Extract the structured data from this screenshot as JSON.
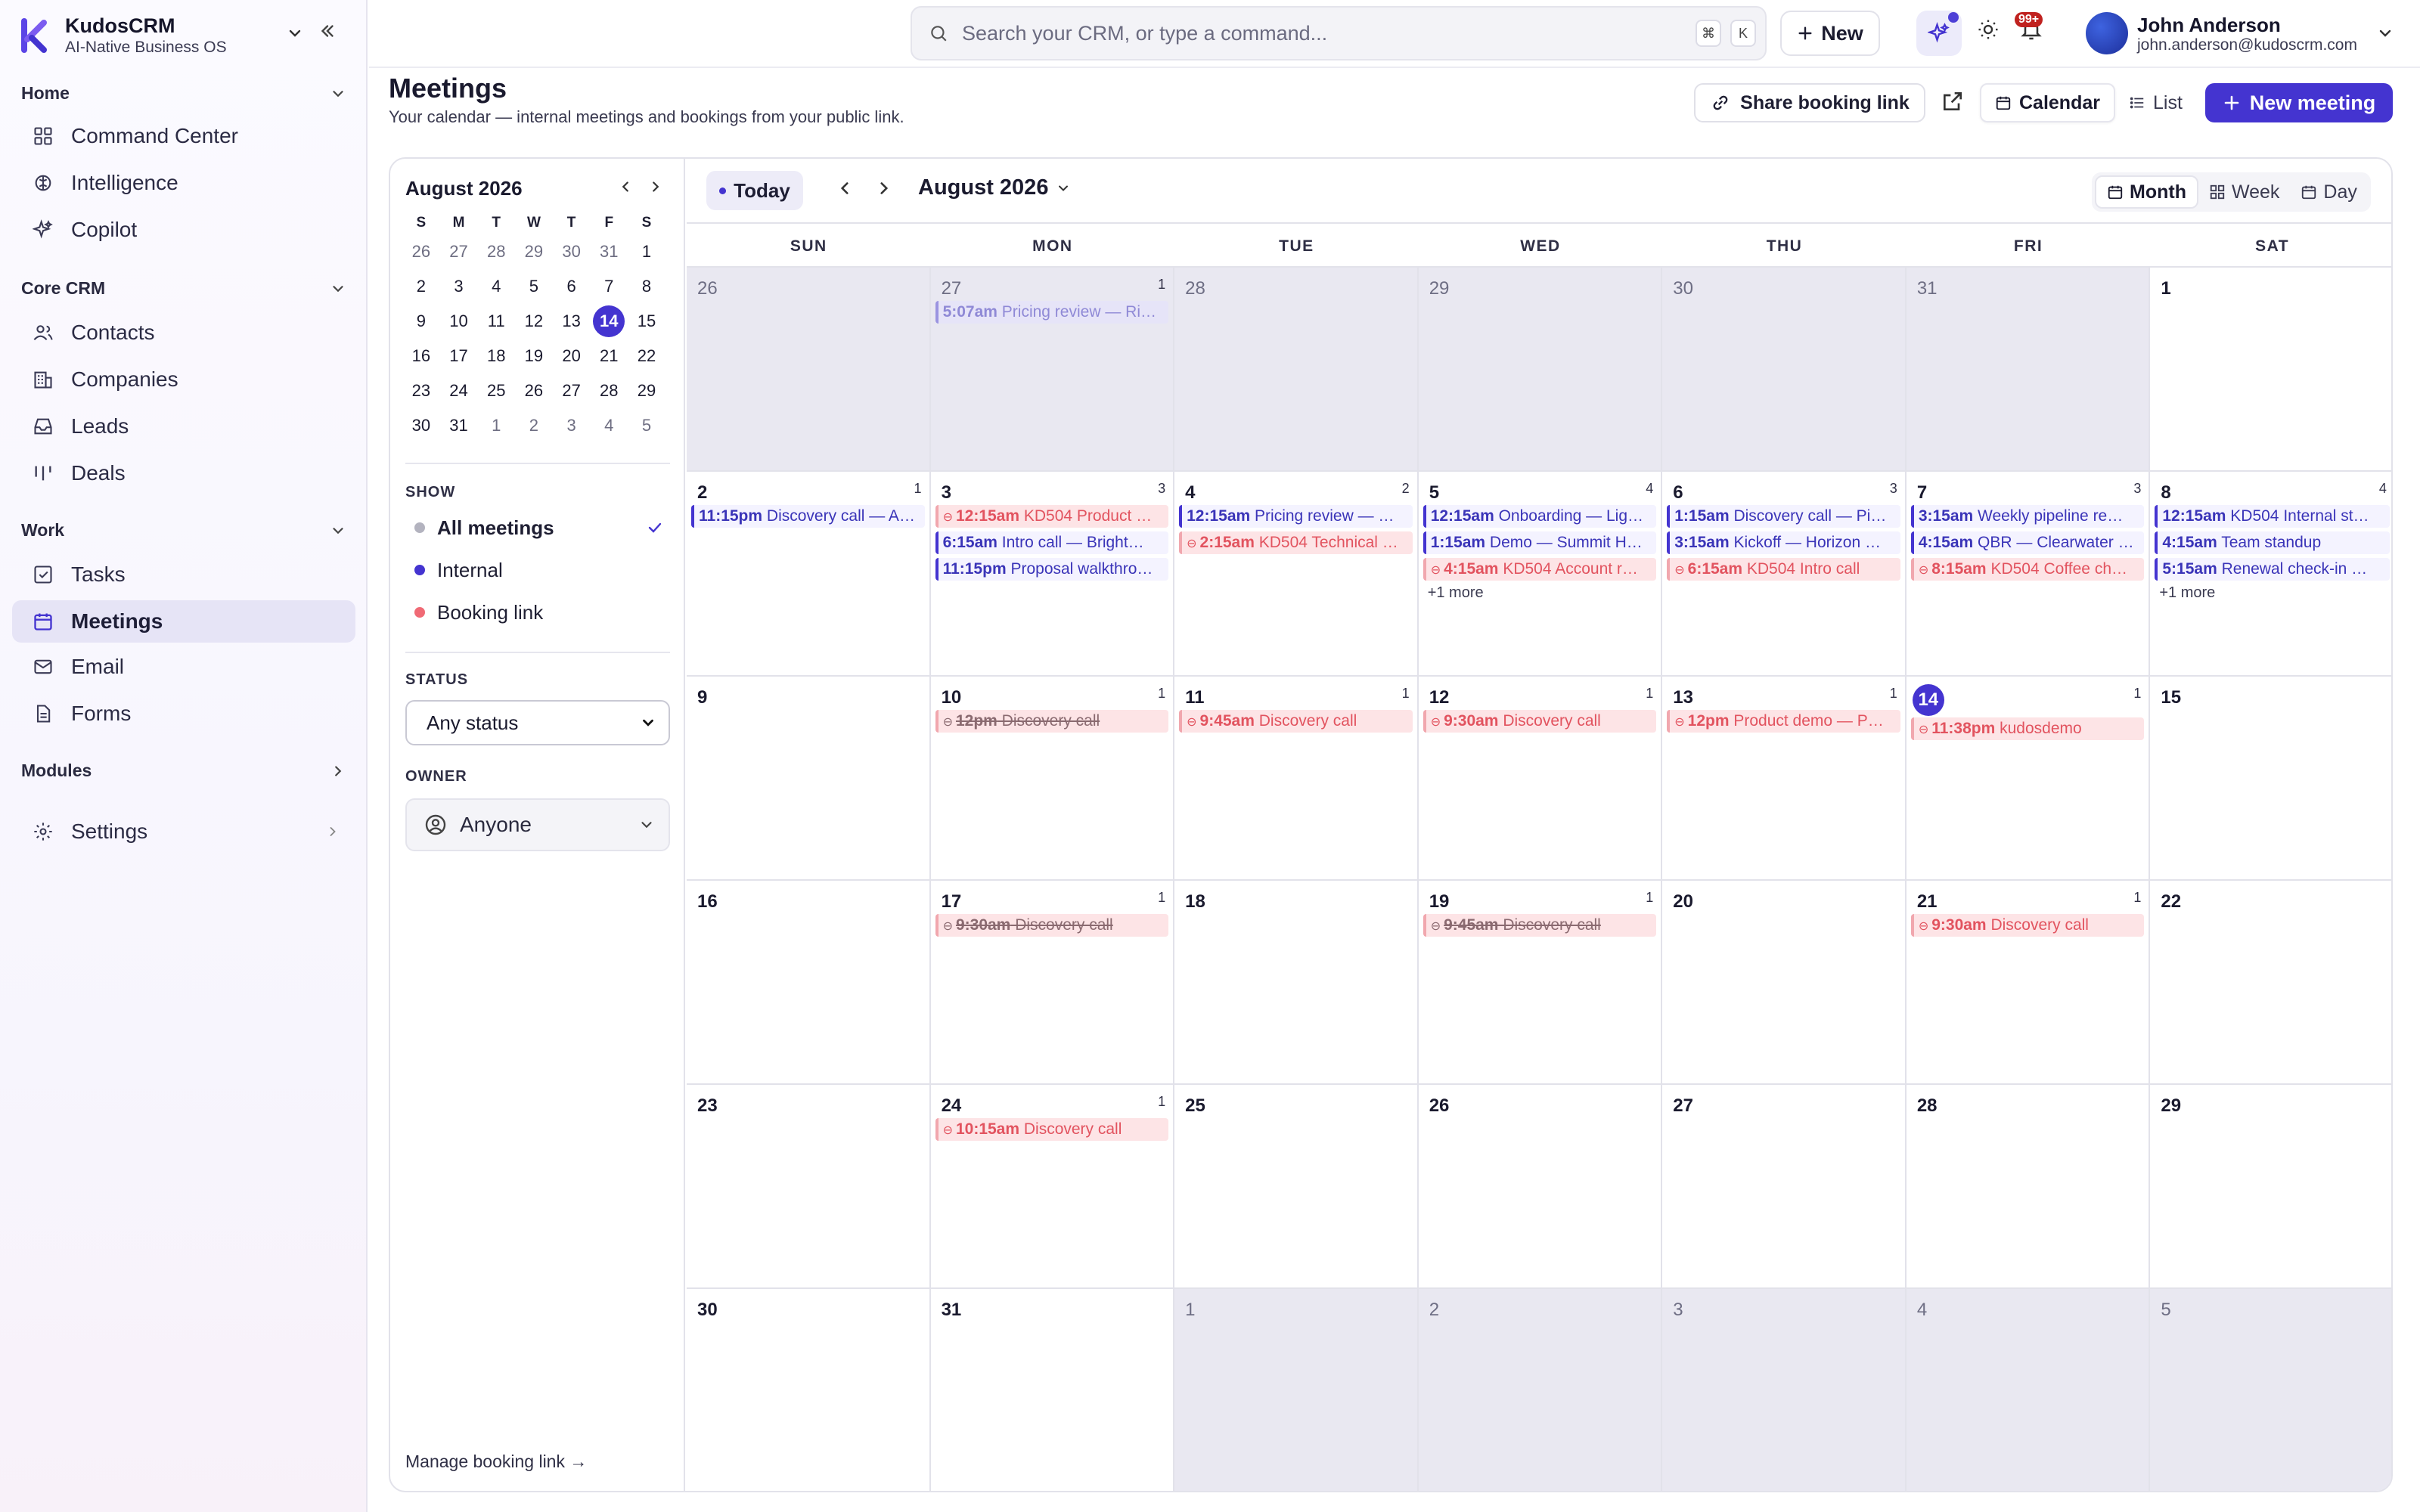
{
  "brand": {
    "name": "KudosCRM",
    "tagline": "AI-Native Business OS"
  },
  "sidebar": {
    "sections": [
      {
        "label": "Home"
      },
      {
        "label": "Core CRM"
      },
      {
        "label": "Work"
      },
      {
        "label": "Modules"
      }
    ],
    "items": [
      {
        "label": "Command Center",
        "icon": "grid-icon"
      },
      {
        "label": "Intelligence",
        "icon": "brain-icon"
      },
      {
        "label": "Copilot",
        "icon": "sparkle-icon"
      },
      {
        "label": "Contacts",
        "icon": "users-icon"
      },
      {
        "label": "Companies",
        "icon": "building-icon"
      },
      {
        "label": "Leads",
        "icon": "inbox-icon"
      },
      {
        "label": "Deals",
        "icon": "kanban-icon"
      },
      {
        "label": "Tasks",
        "icon": "checkbox-icon"
      },
      {
        "label": "Meetings",
        "icon": "calendar-icon"
      },
      {
        "label": "Email",
        "icon": "mail-icon"
      },
      {
        "label": "Forms",
        "icon": "document-icon"
      },
      {
        "label": "Settings",
        "icon": "gear-icon"
      }
    ],
    "active": "Meetings"
  },
  "topbar": {
    "search_placeholder": "Search your CRM, or type a command...",
    "kbd1": "⌘",
    "kbd2": "K",
    "new_label": "New",
    "notifications": "99+",
    "user_name": "John Anderson",
    "user_email": "john.anderson@kudoscrm.com"
  },
  "page": {
    "title": "Meetings",
    "subtitle": "Your calendar — internal meetings and bookings from your public link.",
    "share_label": "Share booking link",
    "view_calendar": "Calendar",
    "view_list": "List",
    "new_meeting": "New meeting"
  },
  "mini": {
    "title": "August 2026",
    "dows": [
      "S",
      "M",
      "T",
      "W",
      "T",
      "F",
      "S"
    ],
    "weeks": [
      [
        "26",
        "27",
        "28",
        "29",
        "30",
        "31",
        "1"
      ],
      [
        "2",
        "3",
        "4",
        "5",
        "6",
        "7",
        "8"
      ],
      [
        "9",
        "10",
        "11",
        "12",
        "13",
        "14",
        "15"
      ],
      [
        "16",
        "17",
        "18",
        "19",
        "20",
        "21",
        "22"
      ],
      [
        "23",
        "24",
        "25",
        "26",
        "27",
        "28",
        "29"
      ],
      [
        "30",
        "31",
        "1",
        "2",
        "3",
        "4",
        "5"
      ]
    ],
    "today": "14"
  },
  "filters": {
    "show_label": "SHOW",
    "show": [
      {
        "label": "All meetings",
        "color": "#b3b3bf"
      },
      {
        "label": "Internal",
        "color": "#4434d0"
      },
      {
        "label": "Booking link",
        "color": "#f06a75"
      }
    ],
    "status_label": "STATUS",
    "status_value": "Any status",
    "owner_label": "OWNER",
    "owner_value": "Anyone",
    "manage_link": "Manage booking link →"
  },
  "calendar": {
    "today_label": "Today",
    "month_label": "August 2026",
    "ranges": [
      "Month",
      "Week",
      "Day"
    ],
    "dows": [
      "SUN",
      "MON",
      "TUE",
      "WED",
      "THU",
      "FRI",
      "SAT"
    ],
    "weeks": [
      [
        {
          "d": "26",
          "other": true
        },
        {
          "d": "27",
          "other": true,
          "count": "1",
          "events": [
            {
              "t": "5:07am",
              "title": "Pricing review — Ri…",
              "k": "internal past"
            }
          ]
        },
        {
          "d": "28",
          "other": true
        },
        {
          "d": "29",
          "other": true
        },
        {
          "d": "30",
          "other": true
        },
        {
          "d": "31",
          "other": true
        },
        {
          "d": "1"
        }
      ],
      [
        {
          "d": "2",
          "count": "1",
          "events": [
            {
              "t": "11:15pm",
              "title": "Discovery call — A…",
              "k": "internal"
            }
          ]
        },
        {
          "d": "3",
          "count": "3",
          "events": [
            {
              "t": "12:15am",
              "title": "KD504 Product …",
              "k": "booking"
            },
            {
              "t": "6:15am",
              "title": "Intro call — Bright…",
              "k": "internal"
            },
            {
              "t": "11:15pm",
              "title": "Proposal walkthro…",
              "k": "internal"
            }
          ]
        },
        {
          "d": "4",
          "count": "2",
          "events": [
            {
              "t": "12:15am",
              "title": "Pricing review — …",
              "k": "internal"
            },
            {
              "t": "2:15am",
              "title": "KD504 Technical …",
              "k": "booking"
            }
          ]
        },
        {
          "d": "5",
          "count": "4",
          "events": [
            {
              "t": "12:15am",
              "title": "Onboarding — Lig…",
              "k": "internal"
            },
            {
              "t": "1:15am",
              "title": "Demo — Summit H…",
              "k": "internal"
            },
            {
              "t": "4:15am",
              "title": "KD504 Account r…",
              "k": "booking"
            }
          ],
          "more": "+1 more"
        },
        {
          "d": "6",
          "count": "3",
          "events": [
            {
              "t": "1:15am",
              "title": "Discovery call — Pi…",
              "k": "internal"
            },
            {
              "t": "3:15am",
              "title": "Kickoff — Horizon …",
              "k": "internal"
            },
            {
              "t": "6:15am",
              "title": "KD504 Intro call",
              "k": "booking"
            }
          ]
        },
        {
          "d": "7",
          "count": "3",
          "events": [
            {
              "t": "3:15am",
              "title": "Weekly pipeline re…",
              "k": "internal"
            },
            {
              "t": "4:15am",
              "title": "QBR — Clearwater …",
              "k": "internal"
            },
            {
              "t": "8:15am",
              "title": "KD504 Coffee ch…",
              "k": "booking"
            }
          ]
        },
        {
          "d": "8",
          "count": "4",
          "events": [
            {
              "t": "12:15am",
              "title": "KD504 Internal st…",
              "k": "internal"
            },
            {
              "t": "4:15am",
              "title": "Team standup",
              "k": "internal"
            },
            {
              "t": "5:15am",
              "title": "Renewal check-in …",
              "k": "internal"
            }
          ],
          "more": "+1 more"
        }
      ],
      [
        {
          "d": "9"
        },
        {
          "d": "10",
          "count": "1",
          "events": [
            {
              "t": "12pm",
              "title": "Discovery call",
              "k": "booking cancel"
            }
          ]
        },
        {
          "d": "11",
          "count": "1",
          "events": [
            {
              "t": "9:45am",
              "title": "Discovery call",
              "k": "booking"
            }
          ]
        },
        {
          "d": "12",
          "count": "1",
          "events": [
            {
              "t": "9:30am",
              "title": "Discovery call",
              "k": "booking"
            }
          ]
        },
        {
          "d": "13",
          "count": "1",
          "events": [
            {
              "t": "12pm",
              "title": "Product demo — P…",
              "k": "booking"
            }
          ]
        },
        {
          "d": "14",
          "count": "1",
          "today": true,
          "events": [
            {
              "t": "11:38pm",
              "title": "kudosdemo",
              "k": "booking"
            }
          ]
        },
        {
          "d": "15"
        }
      ],
      [
        {
          "d": "16"
        },
        {
          "d": "17",
          "count": "1",
          "events": [
            {
              "t": "9:30am",
              "title": "Discovery call",
              "k": "booking cancel"
            }
          ]
        },
        {
          "d": "18"
        },
        {
          "d": "19",
          "count": "1",
          "events": [
            {
              "t": "9:45am",
              "title": "Discovery call",
              "k": "booking cancel"
            }
          ]
        },
        {
          "d": "20"
        },
        {
          "d": "21",
          "count": "1",
          "events": [
            {
              "t": "9:30am",
              "title": "Discovery call",
              "k": "booking"
            }
          ]
        },
        {
          "d": "22"
        }
      ],
      [
        {
          "d": "23"
        },
        {
          "d": "24",
          "count": "1",
          "events": [
            {
              "t": "10:15am",
              "title": "Discovery call",
              "k": "booking"
            }
          ]
        },
        {
          "d": "25"
        },
        {
          "d": "26"
        },
        {
          "d": "27"
        },
        {
          "d": "28"
        },
        {
          "d": "29"
        }
      ],
      [
        {
          "d": "30"
        },
        {
          "d": "31"
        },
        {
          "d": "1",
          "other": true
        },
        {
          "d": "2",
          "other": true
        },
        {
          "d": "3",
          "other": true
        },
        {
          "d": "4",
          "other": true
        },
        {
          "d": "5",
          "other": true
        }
      ]
    ]
  },
  "colors": {
    "accent": "#4434d0",
    "booking": "#e2535f",
    "booking_bg": "#fde4e6"
  }
}
